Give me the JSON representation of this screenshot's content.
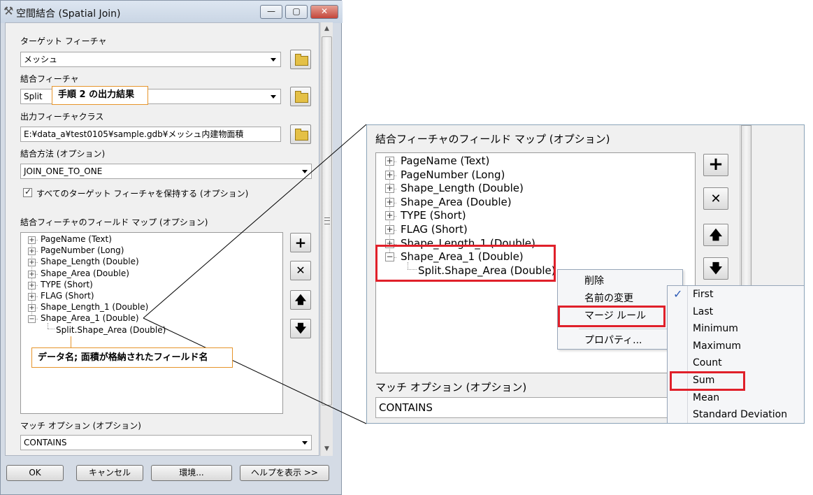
{
  "dialog": {
    "title": "空間結合 (Spatial Join)",
    "target": {
      "label": "ターゲット フィーチャ",
      "value": "メッシュ"
    },
    "join": {
      "label": "結合フィーチャ",
      "value": "Split"
    },
    "output": {
      "label": "出力フィーチャクラス",
      "value": "E:¥data_a¥test0105¥sample.gdb¥メッシュ内建物面積"
    },
    "method": {
      "label": "結合方法 (オプション)",
      "value": "JOIN_ONE_TO_ONE"
    },
    "keep_all": {
      "label": "すべてのターゲット フィーチャを保持する (オプション)",
      "checked": true
    },
    "fieldmap": {
      "label": "結合フィーチャのフィールド マップ (オプション)",
      "items": [
        "PageName (Text)",
        "PageNumber (Long)",
        "Shape_Length (Double)",
        "Shape_Area (Double)",
        "TYPE (Short)",
        "FLAG (Short)",
        "Shape_Length_1 (Double)",
        "Shape_Area_1 (Double)"
      ],
      "child": "Split.Shape_Area (Double)"
    },
    "match": {
      "label": "マッチ オプション (オプション)",
      "value": "CONTAINS"
    },
    "buttons": {
      "ok": "OK",
      "cancel": "キャンセル",
      "env": "環境...",
      "help": "ヘルプを表示 >>"
    }
  },
  "notes": {
    "split_note": "手順 2 の出力結果",
    "data_note": "データ名; 面積が格納されたフィールド名"
  },
  "zoom": {
    "label": "結合フィーチャのフィールド マップ (オプション)",
    "items": [
      "PageName (Text)",
      "PageNumber (Long)",
      "Shape_Length (Double)",
      "Shape_Area (Double)",
      "TYPE (Short)",
      "FLAG (Short)",
      "Shape_Length_1 (Double)",
      "Shape_Area_1 (Double)"
    ],
    "child": "Split.Shape_Area (Double)",
    "context_menu": [
      "削除",
      "名前の変更",
      "マージ ルール",
      "プロパティ..."
    ],
    "merge_rules": [
      "First",
      "Last",
      "Minimum",
      "Maximum",
      "Count",
      "Sum",
      "Mean",
      "Standard Deviation"
    ],
    "checked_rule": "First",
    "match_label": "マッチ オプション (オプション)",
    "match_value": "CONTAINS"
  },
  "glyphs": {
    "tool": "⚒",
    "minimize": "—",
    "maximize": "▢",
    "close": "✕",
    "plus": "+",
    "minus": "−",
    "delete": "✕",
    "up": "🡅",
    "down": "🡇",
    "check": "✓",
    "scroll_up": "▲",
    "scroll_down": "▼"
  },
  "colors": {
    "accent": "#e0202a",
    "note_border": "#e6942a"
  }
}
